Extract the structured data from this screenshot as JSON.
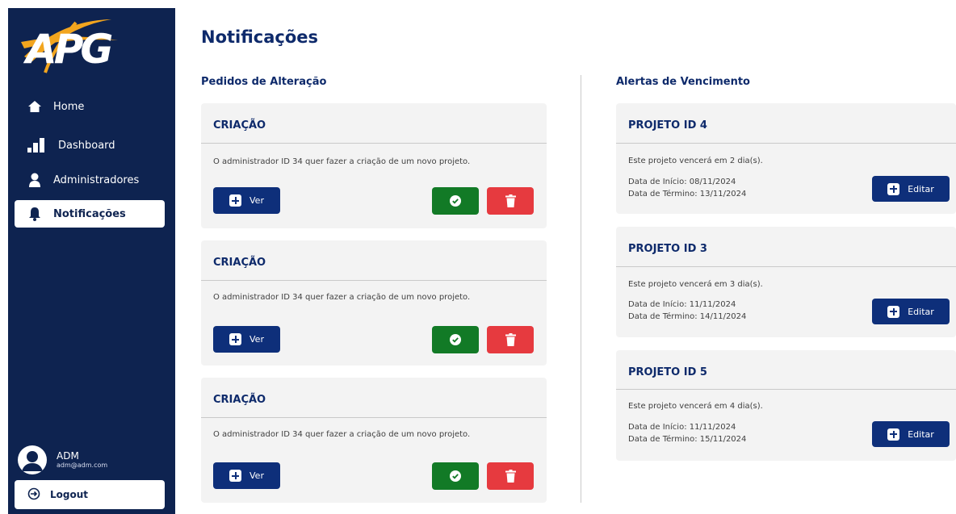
{
  "sidebar": {
    "logo_text": "APG",
    "items": [
      {
        "label": "Home",
        "icon": "home-icon"
      },
      {
        "label": "Dashboard",
        "icon": "bar-chart-icon"
      },
      {
        "label": "Administradores",
        "icon": "user-icon"
      },
      {
        "label": "Notificações",
        "icon": "bell-icon",
        "active": true
      }
    ],
    "user": {
      "name": "ADM",
      "email": "adm@adm.com"
    },
    "logout_label": "Logout"
  },
  "page": {
    "title": "Notificações"
  },
  "requests": {
    "title": "Pedidos de Alteração",
    "cards": [
      {
        "title": "CRIAÇÃO",
        "text": "O administrador ID 34 quer fazer a criação de um novo projeto.",
        "view_label": "Ver"
      },
      {
        "title": "CRIAÇÃO",
        "text": "O administrador ID 34 quer fazer a criação de um novo projeto.",
        "view_label": "Ver"
      },
      {
        "title": "CRIAÇÃO",
        "text": "O administrador ID 34 quer fazer a criação de um novo projeto.",
        "view_label": "Ver"
      }
    ]
  },
  "alerts": {
    "title": "Alertas de Vencimento",
    "cards": [
      {
        "title": "PROJETO ID 4",
        "text": "Este projeto vencerá em 2 dia(s).",
        "start": "Data de Início: 08/11/2024",
        "end": "Data de Término: 13/11/2024",
        "edit_label": "Editar"
      },
      {
        "title": "PROJETO ID 3",
        "text": "Este projeto vencerá em 3 dia(s).",
        "start": "Data de Início: 11/11/2024",
        "end": "Data de Término: 14/11/2024",
        "edit_label": "Editar"
      },
      {
        "title": "PROJETO ID 5",
        "text": "Este projeto vencerá em 4 dia(s).",
        "start": "Data de Início: 11/11/2024",
        "end": "Data de Término: 15/11/2024",
        "edit_label": "Editar"
      }
    ]
  },
  "colors": {
    "sidebar_bg": "#0e2350",
    "primary": "#0e2f7a",
    "approve": "#127a26",
    "delete": "#e63a3f",
    "card_bg": "#f3f3f3"
  }
}
